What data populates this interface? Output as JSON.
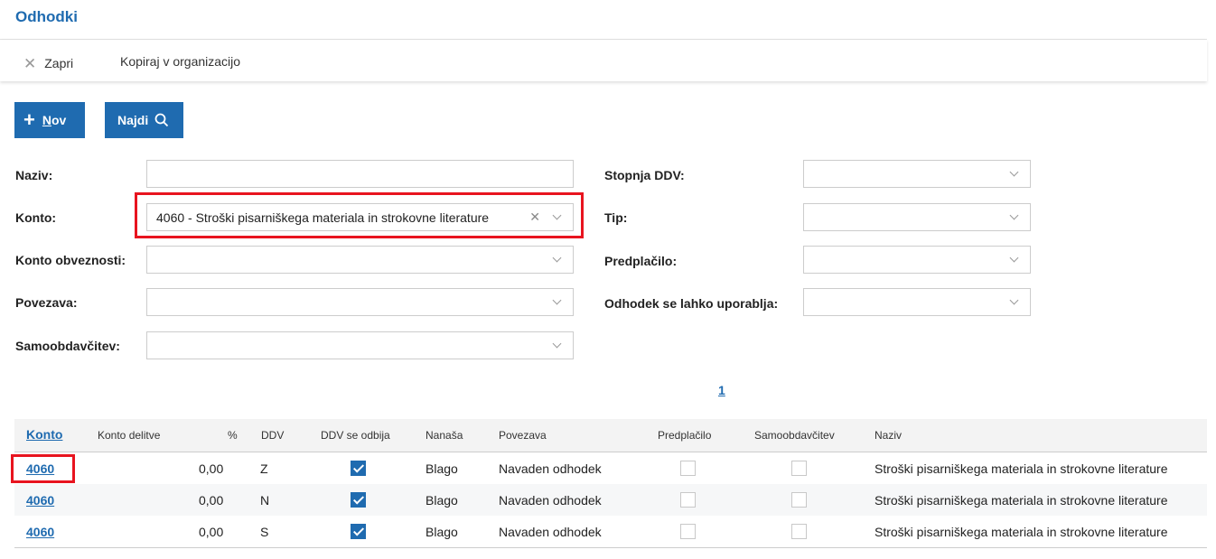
{
  "page": {
    "title": "Odhodki"
  },
  "toolbar": {
    "close_label": "Zapri",
    "copy_label": "Kopiraj v organizacijo"
  },
  "buttons": {
    "new_label": "Nov",
    "find_label": "Najdi"
  },
  "filters": {
    "naziv": {
      "label": "Naziv:",
      "value": ""
    },
    "konto": {
      "label": "Konto:",
      "value": "4060 - Stroški pisarniškega materiala in strokovne literature"
    },
    "konto_obveznosti": {
      "label": "Konto obveznosti:",
      "value": ""
    },
    "povezava": {
      "label": "Povezava:",
      "value": ""
    },
    "samoobdavcitev": {
      "label": "Samoobdavčitev:",
      "value": ""
    },
    "stopnja_ddv": {
      "label": "Stopnja DDV:",
      "value": ""
    },
    "tip": {
      "label": "Tip:",
      "value": ""
    },
    "predplacilo": {
      "label": "Predplačilo:",
      "value": ""
    },
    "uporablja": {
      "label": "Odhodek se lahko uporablja:",
      "value": ""
    }
  },
  "pagination": {
    "current": "1"
  },
  "table": {
    "headers": {
      "konto": "Konto",
      "konto_delitve": "Konto delitve",
      "pct": "%",
      "ddv": "DDV",
      "ddv_odbija": "DDV se odbija",
      "nanasa": "Nanaša",
      "povezava": "Povezava",
      "predplacilo": "Predplačilo",
      "samoobdavcitev": "Samoobdavčitev",
      "naziv": "Naziv"
    },
    "rows": [
      {
        "konto": "4060",
        "konto_delitve": "",
        "pct": "0,00",
        "ddv": "Z",
        "ddv_odbija": true,
        "nanasa": "Blago",
        "povezava": "Navaden odhodek",
        "predplacilo": false,
        "samoobdavcitev": false,
        "naziv": "Stroški pisarniškega materiala in strokovne literature"
      },
      {
        "konto": "4060",
        "konto_delitve": "",
        "pct": "0,00",
        "ddv": "N",
        "ddv_odbija": true,
        "nanasa": "Blago",
        "povezava": "Navaden odhodek",
        "predplacilo": false,
        "samoobdavcitev": false,
        "naziv": "Stroški pisarniškega materiala in strokovne literature"
      },
      {
        "konto": "4060",
        "konto_delitve": "",
        "pct": "0,00",
        "ddv": "S",
        "ddv_odbija": true,
        "nanasa": "Blago",
        "povezava": "Navaden odhodek",
        "predplacilo": false,
        "samoobdavcitev": false,
        "naziv": "Stroški pisarniškega materiala in strokovne literature"
      }
    ]
  },
  "colors": {
    "accent": "#1f6bb0",
    "highlight": "#e8141f"
  }
}
